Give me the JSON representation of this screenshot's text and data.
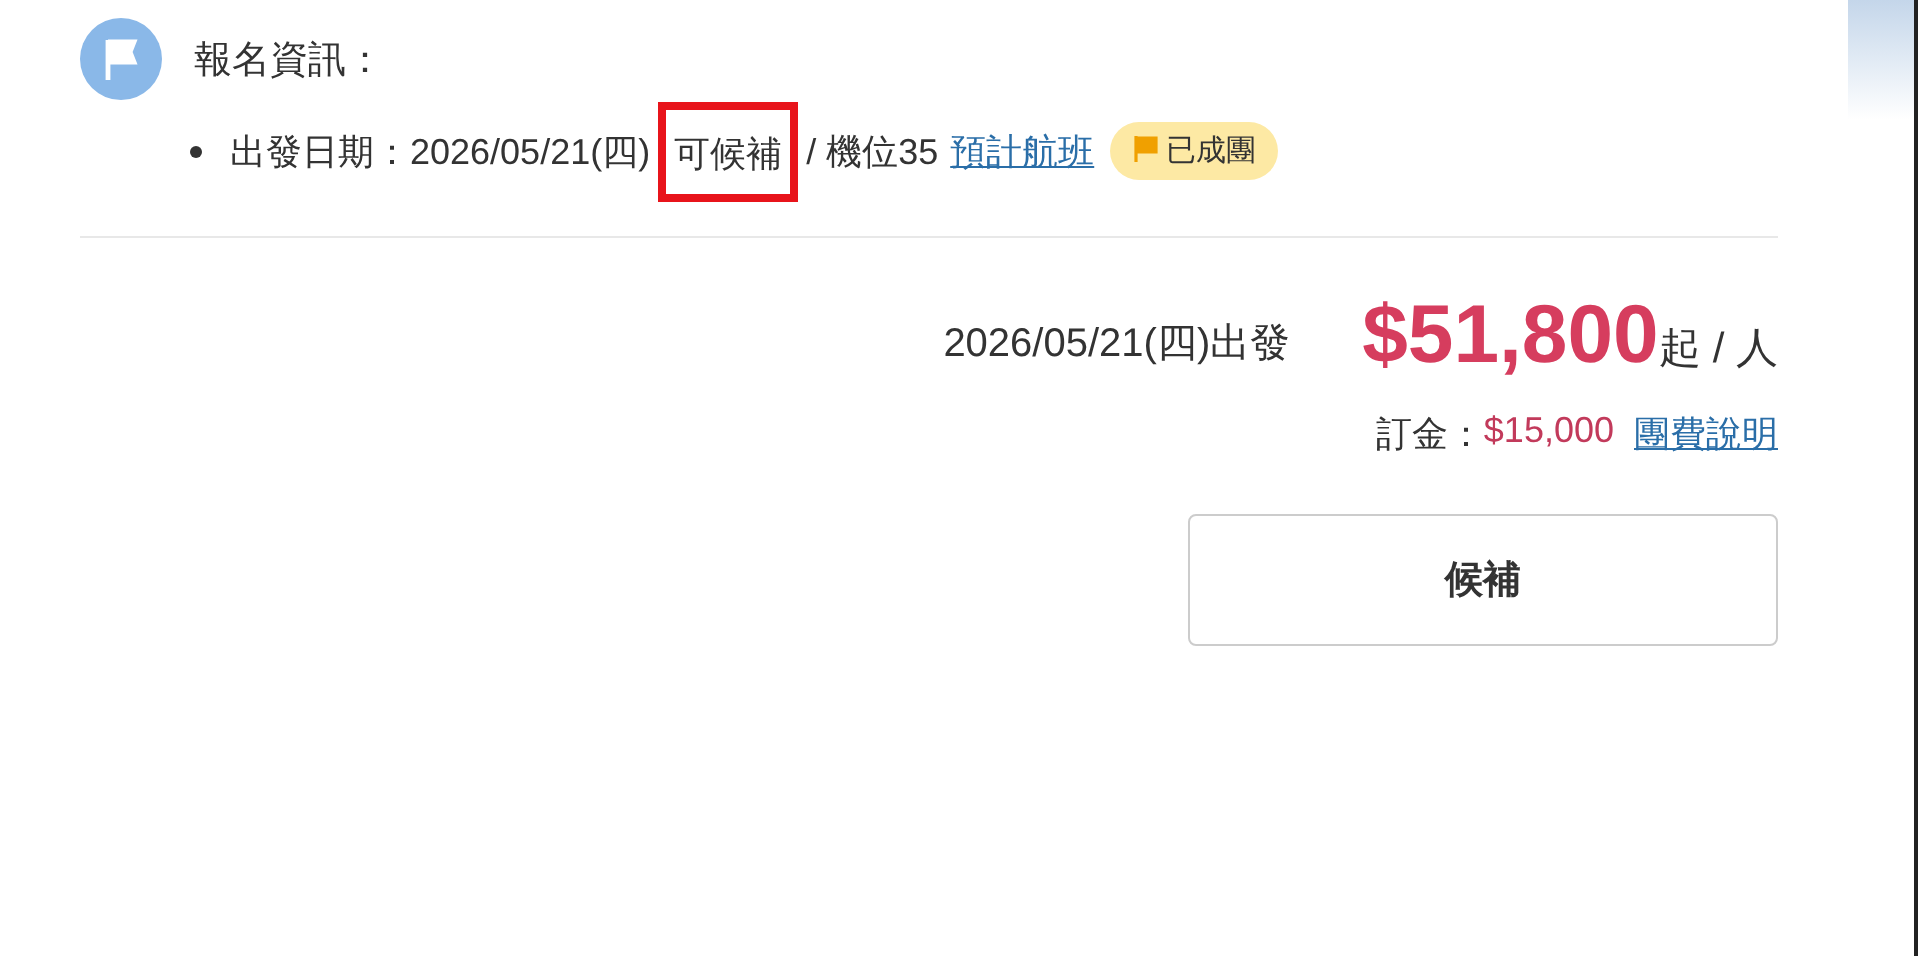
{
  "signup_info": {
    "heading": "報名資訊：",
    "departure_label": "出發日期：2026/05/21(四)",
    "status": {
      "text": "可候補",
      "highlighted": true
    },
    "seats": "/ 機位35",
    "flight_link": "預計航班",
    "badge": {
      "text": "已成團"
    }
  },
  "price": {
    "departure": "2026/05/21(四)出發",
    "amount": "$51,800",
    "suffix": "起",
    "per": "/ 人",
    "deposit_label": "訂金：",
    "deposit": "$15,000",
    "fee_link": "團費說明"
  },
  "button": {
    "label": "候補"
  }
}
